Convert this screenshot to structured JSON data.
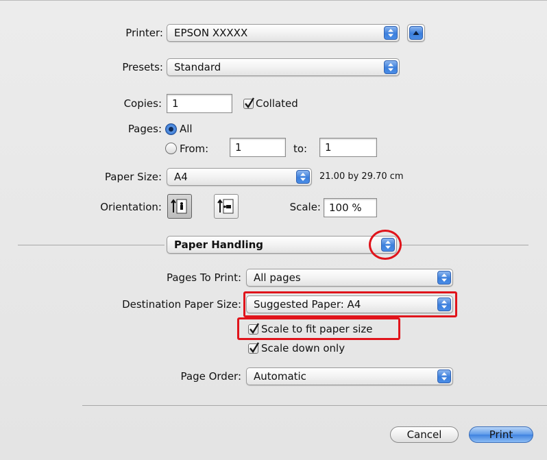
{
  "printer": {
    "label": "Printer:",
    "value": "EPSON XXXXX"
  },
  "presets": {
    "label": "Presets:",
    "value": "Standard"
  },
  "copies": {
    "label": "Copies:",
    "value": "1",
    "collated_label": "Collated",
    "collated": true
  },
  "pages": {
    "label": "Pages:",
    "all_label": "All",
    "from_label": "From:",
    "from_value": "1",
    "to_label": "to:",
    "to_value": "1",
    "selected": "All"
  },
  "paper_size": {
    "label": "Paper Size:",
    "value": "A4",
    "dimensions": "21.00 by 29.70 cm"
  },
  "orientation": {
    "label": "Orientation:",
    "selected": "portrait"
  },
  "scale": {
    "label": "Scale:",
    "value": "100 %"
  },
  "panel": {
    "value": "Paper Handling"
  },
  "pages_to_print": {
    "label": "Pages To Print:",
    "value": "All pages"
  },
  "destination_paper_size": {
    "label": "Destination Paper Size:",
    "value": "Suggested Paper: A4"
  },
  "scale_to_fit": {
    "label": "Scale to fit paper size",
    "checked": true
  },
  "scale_down_only": {
    "label": "Scale down only",
    "checked": true
  },
  "page_order": {
    "label": "Page Order:",
    "value": "Automatic"
  },
  "buttons": {
    "cancel": "Cancel",
    "print": "Print"
  },
  "colors": {
    "highlight": "#e0141b",
    "accent": "#3f82e0"
  }
}
